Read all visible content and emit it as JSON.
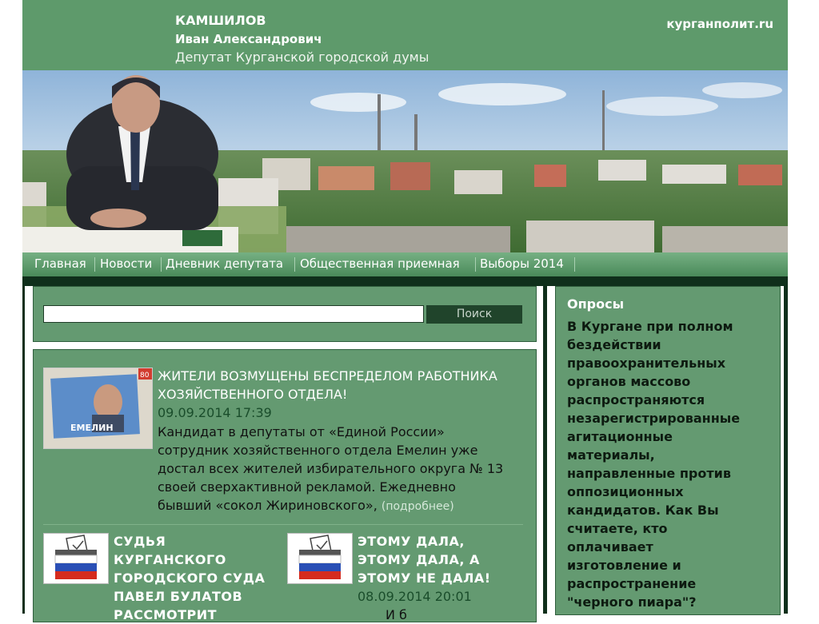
{
  "header": {
    "name_line1": "КАМШИЛОВ",
    "name_line2": "Иван Александрович",
    "subtitle": "Депутат Курганской городской думы",
    "site": "курганполит.ru"
  },
  "nav": {
    "items": [
      {
        "label": "Главная"
      },
      {
        "label": "Новости"
      },
      {
        "label": "Дневник депутата"
      },
      {
        "label": "Общественная приемная"
      },
      {
        "label": "Выборы 2014"
      }
    ]
  },
  "search": {
    "value": "",
    "button_label": "Поиск"
  },
  "news_main": {
    "title_line1": "ЖИТЕЛИ ВОЗМУЩЕНЫ БЕСПРЕДЕЛОМ РАБОТНИКА",
    "title_line2": "ХОЗЯЙСТВЕННОГО ОТДЕЛА!",
    "date": "09.09.2014 17:39",
    "text_lines": [
      "Кандидат в депутаты от «Единой России»",
      "сотрудник хозяйственного отдела Емелин уже",
      "достал всех жителей избирательного округа № 13",
      "своей сверхактивной рекламой. Ежедневно",
      "бывший «сокол Жириновского»,"
    ],
    "more": "(подробнее)",
    "thumb_caption": "ЕМЕЛИН",
    "thumb_number": "80"
  },
  "news_small": [
    {
      "title_lines": [
        "СУДЬЯ",
        "КУРГАНСКОГО",
        "ГОРОДСКОГО СУДА",
        "ПАВЕЛ БУЛАТОВ",
        "РАССМОТРИТ"
      ]
    },
    {
      "title_lines": [
        "ЭТОМУ ДАЛА,",
        "ЭТОМУ ДАЛА, А",
        "ЭТОМУ НЕ ДАЛА!"
      ],
      "date": "08.09.2014 20:01",
      "text_partial": "И б"
    }
  ],
  "poll": {
    "heading": "Опросы",
    "question_lines": [
      "В Кургане при полном",
      "бездействии",
      "правоохранительных",
      "органов массово",
      "распространяются",
      "незарегистрированные",
      "агитационные",
      "материалы,",
      "направленные против",
      "оппозиционных",
      "кандидатов. Как Вы",
      "считаете, кто",
      "оплачивает",
      "изготовление и",
      "распространение",
      "\"черного пиара\"?"
    ]
  },
  "colors": {
    "brand_green": "#649a71",
    "dark_green": "#0f2f1b",
    "button_dark": "#20442b"
  }
}
